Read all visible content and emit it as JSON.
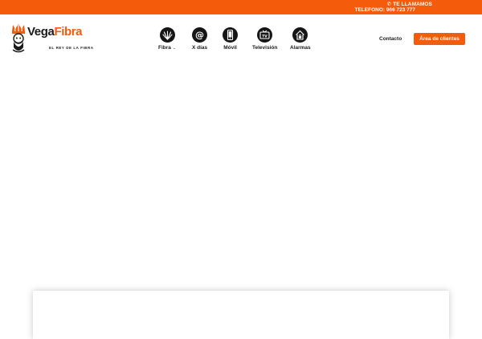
{
  "topbar": {
    "callback_label": "TE LLAMAMOS",
    "callback_icon": "phone-icon",
    "phone_text": "TELEFONO: 966 723 777",
    "background": "#f45b0a"
  },
  "logo": {
    "word1": "Vega",
    "word2": "Fibra",
    "tagline": "EL REY DE LA FIBRA",
    "icon": "king-mascot-icon"
  },
  "nav": {
    "items": [
      {
        "label": "Fibra",
        "icon": "fiber-icon",
        "has_dropdown": true
      },
      {
        "label": "X días",
        "icon": "at-sign-icon"
      },
      {
        "label": "Móvil",
        "icon": "mobile-phone-icon"
      },
      {
        "label": "Televisión",
        "icon": "tv-icon"
      },
      {
        "label": "Alarmas",
        "icon": "home-lock-icon"
      }
    ]
  },
  "header_right": {
    "contact_label": "Contacto",
    "client_area_label": "Área de clientes"
  },
  "colors": {
    "accent": "#f45b0a",
    "icon_bg": "#151515",
    "text": "#1a1a1a"
  }
}
